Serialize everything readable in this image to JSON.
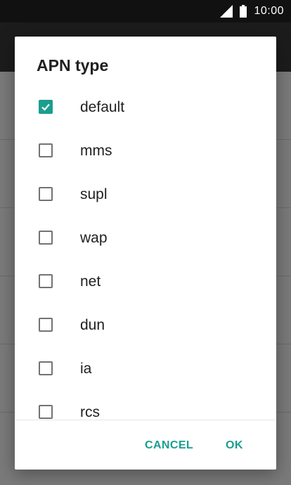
{
  "status_bar": {
    "time": "10:00",
    "signal_icon": "signal-icon",
    "battery_icon": "battery-icon"
  },
  "dialog": {
    "title": "APN type",
    "options": [
      {
        "label": "default",
        "checked": true
      },
      {
        "label": "mms",
        "checked": false
      },
      {
        "label": "supl",
        "checked": false
      },
      {
        "label": "wap",
        "checked": false
      },
      {
        "label": "net",
        "checked": false
      },
      {
        "label": "dun",
        "checked": false
      },
      {
        "label": "ia",
        "checked": false
      },
      {
        "label": "rcs",
        "checked": false
      }
    ],
    "cancel_label": "CANCEL",
    "ok_label": "OK"
  },
  "colors": {
    "accent": "#1a9e8f",
    "checkbox_border": "#737373",
    "text": "#212121"
  }
}
